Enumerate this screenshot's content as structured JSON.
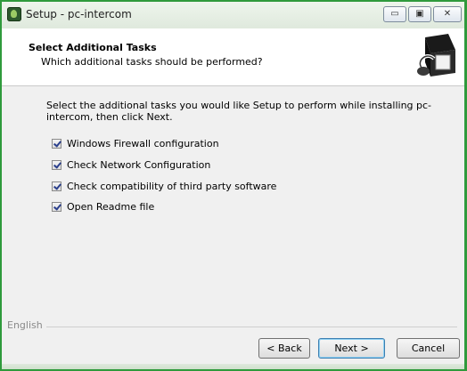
{
  "window": {
    "title": "Setup - pc-intercom",
    "controls": {
      "minimize_glyph": "▭",
      "maximize_glyph": "▣",
      "close_glyph": "✕"
    }
  },
  "header": {
    "title": "Select Additional Tasks",
    "subtitle": "Which additional tasks should be performed?",
    "image_icon": "setup-wizard-icon"
  },
  "intro": "Select the additional tasks you would like Setup to perform while installing pc-intercom, then click Next.",
  "tasks": [
    {
      "label": "Windows Firewall configuration",
      "checked": true
    },
    {
      "label": "Check Network Configuration",
      "checked": true
    },
    {
      "label": "Check compatibility of third party software",
      "checked": true
    },
    {
      "label": "Open Readme file",
      "checked": true
    }
  ],
  "footer": {
    "language": "English",
    "back_label": "< Back",
    "next_label": "Next >",
    "cancel_label": "Cancel"
  },
  "colors": {
    "window_border": "#2f9a3c",
    "header_bg": "#ffffff",
    "checkmark": "#2a3f8c"
  }
}
